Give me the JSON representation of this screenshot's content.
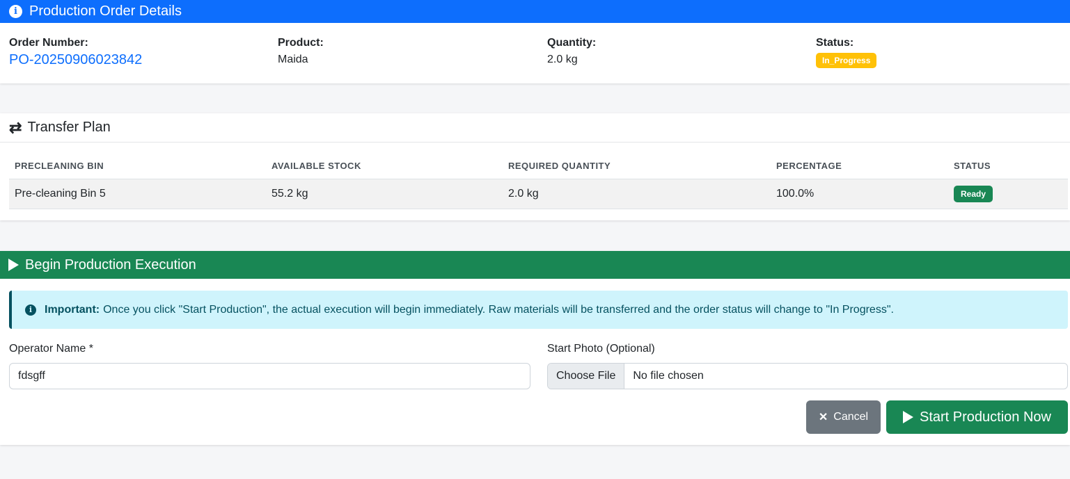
{
  "order_card": {
    "title": "Production Order Details",
    "order_number_label": "Order Number:",
    "order_number": "PO-20250906023842",
    "product_label": "Product:",
    "product": "Maida",
    "quantity_label": "Quantity:",
    "quantity": "2.0 kg",
    "status_label": "Status:",
    "status": "In_Progress"
  },
  "transfer_plan": {
    "title": "Transfer Plan",
    "columns": [
      "PRECLEANING BIN",
      "AVAILABLE STOCK",
      "REQUIRED QUANTITY",
      "PERCENTAGE",
      "STATUS"
    ],
    "rows": [
      {
        "bin": "Pre-cleaning Bin 5",
        "available": "55.2 kg",
        "required": "2.0 kg",
        "percentage": "100.0%",
        "status": "Ready"
      }
    ]
  },
  "execution": {
    "title": "Begin Production Execution",
    "alert_strong": "Important:",
    "alert_text": "Once you click \"Start Production\", the actual execution will begin immediately. Raw materials will be transferred and the order status will change to \"In Progress\".",
    "operator_label": "Operator Name *",
    "operator_value": "fdsgff",
    "photo_label": "Start Photo (Optional)",
    "file_button": "Choose File",
    "file_status": "No file chosen",
    "cancel_label": "Cancel",
    "start_label": "Start Production Now"
  },
  "colors": {
    "primary": "#0d6efd",
    "success": "#198754",
    "warning": "#ffc107",
    "secondary": "#6c757d",
    "info_bg": "#cff4fc"
  }
}
